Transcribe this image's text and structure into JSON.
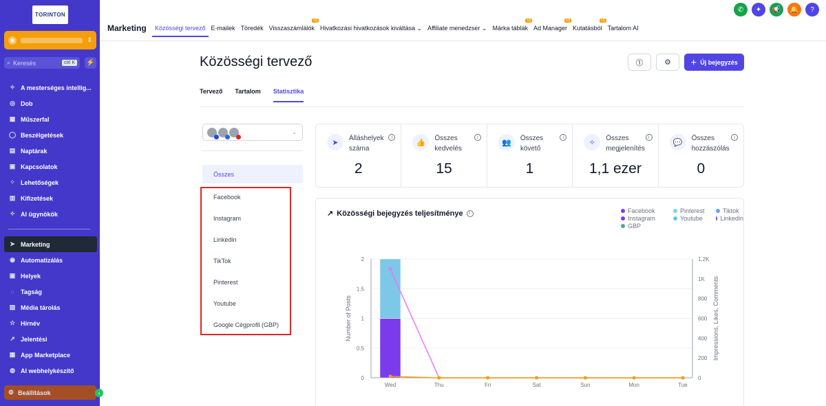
{
  "sidebar": {
    "logo": "TORINTON",
    "search_placeholder": "Keresés",
    "search_kbd": "ctrl K",
    "items_top": [
      {
        "label": "A mesterséges intellig...",
        "icon": "✧"
      },
      {
        "label": "Dob",
        "icon": "◎"
      },
      {
        "label": "Műszerfal",
        "icon": "▦"
      },
      {
        "label": "Beszélgetések",
        "icon": "◯"
      },
      {
        "label": "Naptárak",
        "icon": "▤"
      },
      {
        "label": "Kapcsolatok",
        "icon": "▣"
      },
      {
        "label": "Lehetőségek",
        "icon": "⁘"
      },
      {
        "label": "Kifizetések",
        "icon": "▥"
      },
      {
        "label": "AI ügynökök",
        "icon": "✧"
      }
    ],
    "items_bottom": [
      {
        "label": "Marketing",
        "icon": "➤",
        "active": true
      },
      {
        "label": "Automatizálás",
        "icon": "◉"
      },
      {
        "label": "Helyek",
        "icon": "▣"
      },
      {
        "label": "Tagság",
        "icon": "◌"
      },
      {
        "label": "Média tárolás",
        "icon": "▨"
      },
      {
        "label": "Hírnév",
        "icon": "☆"
      },
      {
        "label": "Jelentési",
        "icon": "↗"
      },
      {
        "label": "App Marketplace",
        "icon": "▦"
      },
      {
        "label": "AI webhelykészítő",
        "icon": "◍"
      }
    ],
    "settings": "Beállítások"
  },
  "header": {
    "title": "Marketing",
    "tabs": [
      {
        "label": "Közösségi tervező",
        "active": true
      },
      {
        "label": "E-mailek"
      },
      {
        "label": "Töredék"
      },
      {
        "label": "Visszaszámlálók",
        "badge": "Új"
      },
      {
        "label": "Hivatkozási hivatkozások kiváltása ⌄"
      },
      {
        "label": "Affiliate menedzser ⌄"
      },
      {
        "label": "Márka táblák",
        "badge": "Új"
      },
      {
        "label": "Ad Manager",
        "badge": "Új"
      },
      {
        "label": "Kutatásból",
        "badge": "Új"
      },
      {
        "label": "Tartalom AI"
      }
    ],
    "action_icons": [
      {
        "name": "phone-icon",
        "glyph": "✆",
        "color": "#16a34a"
      },
      {
        "name": "sparkle-icon",
        "glyph": "✦",
        "color": "#4f46e5"
      },
      {
        "name": "megaphone-icon",
        "glyph": "📢",
        "color": "#16a34a"
      },
      {
        "name": "bell-icon",
        "glyph": "🔔",
        "color": "#f97316"
      },
      {
        "name": "help-icon",
        "glyph": "?",
        "color": "#4f46e5"
      }
    ]
  },
  "main": {
    "title": "Közösségi tervező",
    "new_post": "Új bejegyzés",
    "sub_tabs": [
      {
        "label": "Tervező"
      },
      {
        "label": "Tartalom"
      },
      {
        "label": "Statisztika",
        "active": true
      }
    ],
    "filters": [
      "Összes",
      "Facebook",
      "Instagram",
      "Linkedin",
      "TikTok",
      "Pinterest",
      "Youtube",
      "Google Cégprofil (GBP)"
    ],
    "stats": [
      {
        "label": "Álláshelyek száma",
        "value": "2",
        "icon": "➤"
      },
      {
        "label": "Összes kedvelés",
        "value": "15",
        "icon": "👍"
      },
      {
        "label": "Összes követő",
        "value": "1",
        "icon": "👥"
      },
      {
        "label": "Összes megjelenítés",
        "value": "1,1 ezer",
        "icon": "✧"
      },
      {
        "label": "Összes hozzászólás",
        "value": "0",
        "icon": "💬"
      }
    ],
    "chart_title": "Közösségi bejegyzés teljesítménye"
  },
  "chart_data": {
    "type": "bar",
    "categories": [
      "Wed",
      "Thu",
      "Fri",
      "Sat",
      "Sun",
      "Mon",
      "Tue"
    ],
    "ylabel": "Number of Posts",
    "y2label": "Impressions, Likes, Comments",
    "ylim": [
      0,
      2
    ],
    "y_ticks": [
      "0",
      "0.5",
      "1",
      "1.5",
      "2"
    ],
    "y2lim": [
      0,
      1200
    ],
    "y2_ticks": [
      "0",
      "200",
      "400",
      "600",
      "800",
      "1K",
      "1,2K"
    ],
    "legend": [
      {
        "name": "Facebook",
        "color": "#7c3aed"
      },
      {
        "name": "Pinterest",
        "color": "#7dd3fc"
      },
      {
        "name": "Tiktok",
        "color": "#60a5fa"
      },
      {
        "name": "Instagram",
        "color": "#7c3aed"
      },
      {
        "name": "Youtube",
        "color": "#67c5e6"
      },
      {
        "name": "Linkedin",
        "color": "#6366f1"
      },
      {
        "name": "GBP",
        "color": "#4aa89a"
      }
    ],
    "bars": [
      {
        "name": "Facebook",
        "color": "#7c3aed",
        "values": [
          1,
          0,
          0,
          0,
          0,
          0,
          0
        ]
      },
      {
        "name": "Pinterest",
        "color": "#7dc7e8",
        "values": [
          1,
          0,
          0,
          0,
          0,
          0,
          0
        ]
      }
    ],
    "lines": [
      {
        "name": "Impressions",
        "color": "#e879f9",
        "values": [
          1100,
          0,
          0,
          0,
          0,
          0,
          0
        ]
      },
      {
        "name": "Likes",
        "color": "#f59e0b",
        "values": [
          15,
          0,
          0,
          0,
          0,
          0,
          0
        ]
      }
    ],
    "grid": true,
    "legend_position": "top-right"
  }
}
